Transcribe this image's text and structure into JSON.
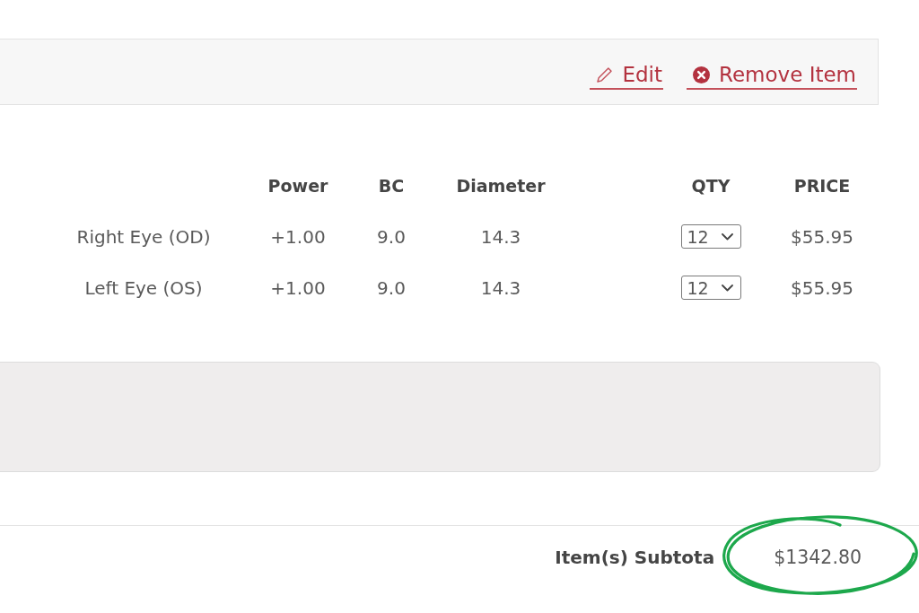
{
  "item_actions": [
    {
      "kind": "edit",
      "label": "Edit"
    },
    {
      "kind": "remove",
      "label": "Remove Item"
    }
  ],
  "table": {
    "columns": [
      "Power",
      "BC",
      "Diameter",
      "QTY",
      "PRICE"
    ],
    "rows": [
      {
        "eye": "Right Eye (OD)",
        "power": "+1.00",
        "bc": "9.0",
        "diameter": "14.3",
        "qty": "12",
        "price": "$55.95"
      },
      {
        "eye": "Left Eye (OS)",
        "power": "+1.00",
        "bc": "9.0",
        "diameter": "14.3",
        "qty": "12",
        "price": "$55.95"
      }
    ]
  },
  "subtotal": {
    "label": "Item(s) Subtota",
    "amount": "$1342.80"
  }
}
